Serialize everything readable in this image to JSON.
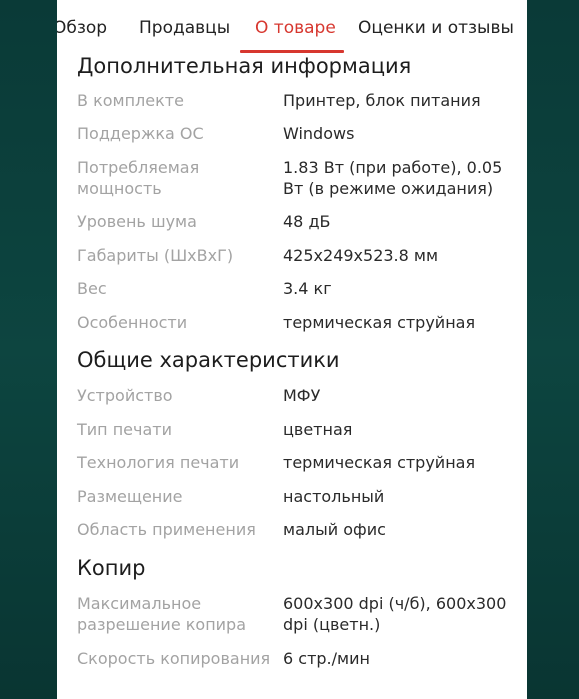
{
  "tabs": [
    {
      "label": "Обзор",
      "active": false
    },
    {
      "label": "Продавцы",
      "active": false
    },
    {
      "label": "О товаре",
      "active": true
    },
    {
      "label": "Оценки и отзывы",
      "active": false
    }
  ],
  "accent_color": "#d7372f",
  "sections": [
    {
      "title": "Дополнительная информация",
      "rows": [
        {
          "label": "В комплекте",
          "value": "Принтер, блок питания"
        },
        {
          "label": "Поддержка ОС",
          "value": "Windows"
        },
        {
          "label": "Потребляемая мощность",
          "value": "1.83 Вт (при работе), 0.05 Вт (в режиме ожидания)"
        },
        {
          "label": "Уровень шума",
          "value": "48 дБ"
        },
        {
          "label": "Габариты (ШхВхГ)",
          "value": "425x249x523.8 мм"
        },
        {
          "label": "Вес",
          "value": "3.4 кг"
        },
        {
          "label": "Особенности",
          "value": "термическая струйная"
        }
      ]
    },
    {
      "title": "Общие характеристики",
      "rows": [
        {
          "label": "Устройство",
          "value": "МФУ"
        },
        {
          "label": "Тип печати",
          "value": "цветная"
        },
        {
          "label": "Технология печати",
          "value": "термическая струйная"
        },
        {
          "label": "Размещение",
          "value": "настольный"
        },
        {
          "label": "Область применения",
          "value": "малый офис"
        }
      ]
    },
    {
      "title": "Копир",
      "rows": [
        {
          "label": "Максимальное разрешение копира",
          "value": "600x300 dpi (ч/б), 600x300 dpi (цветн.)"
        },
        {
          "label": "Скорость копирования",
          "value": "6 стр./мин"
        }
      ]
    }
  ]
}
